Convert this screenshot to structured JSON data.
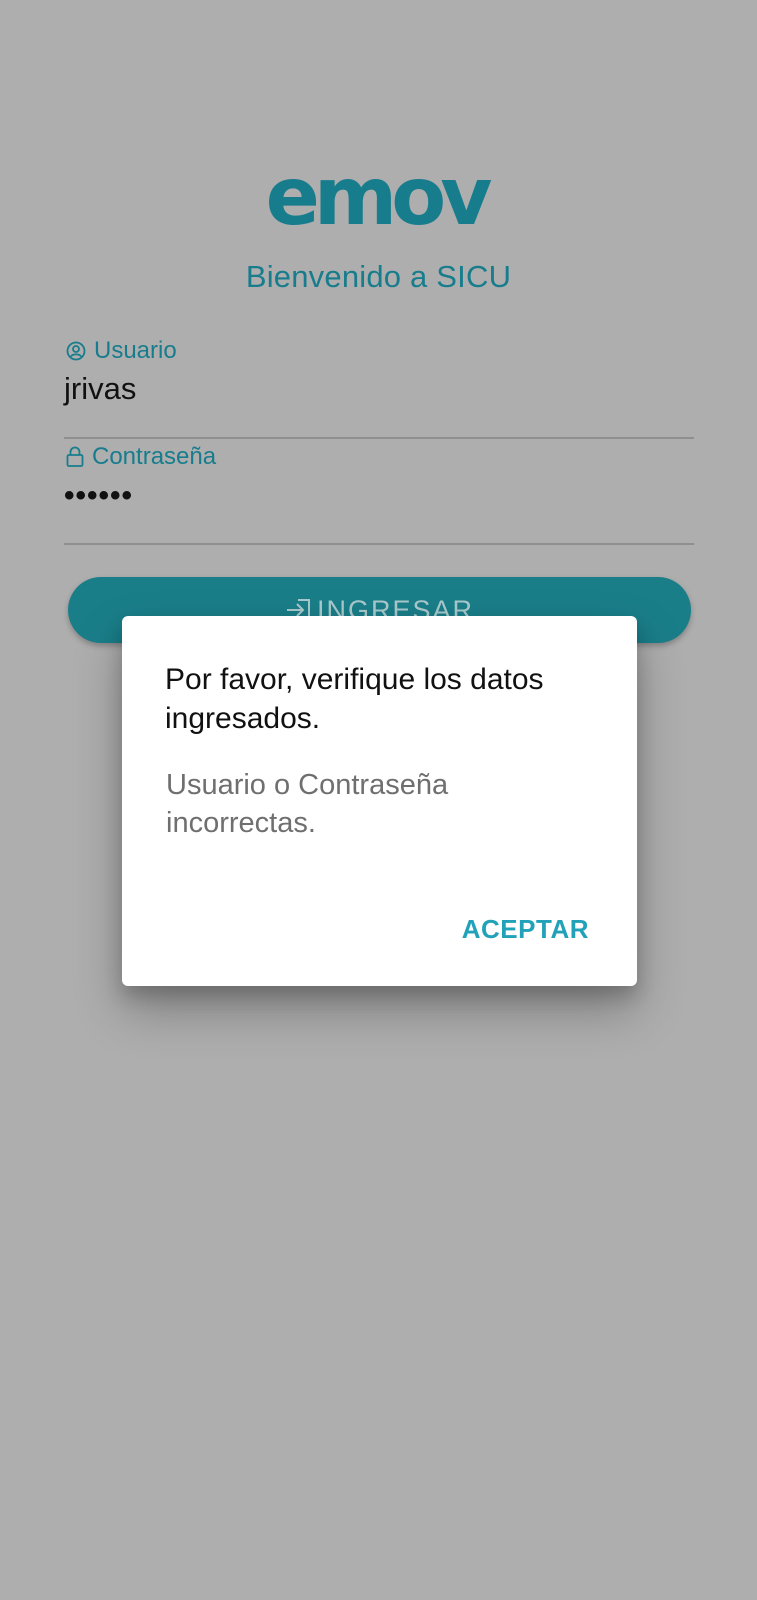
{
  "app": {
    "logo_text": "emov",
    "welcome": "Bienvenido a SICU"
  },
  "form": {
    "user_label": "Usuario",
    "user_value": "jrivas",
    "password_label": "Contraseña",
    "password_value": "••••••",
    "login_button": "INGRESAR"
  },
  "dialog": {
    "title": "Por favor, verifique los datos ingresados.",
    "message": "Usuario o Contraseña incorrectas.",
    "confirm_button": "ACEPTAR"
  },
  "colors": {
    "brand_teal": "#177d8d",
    "button_teal": "#1a7e89",
    "dialog_action": "#22a2b8",
    "scrim_background": "#aeaeae"
  },
  "icons": {
    "user": "user-circle-icon",
    "password": "lock-icon",
    "login": "login-arrow-icon"
  }
}
